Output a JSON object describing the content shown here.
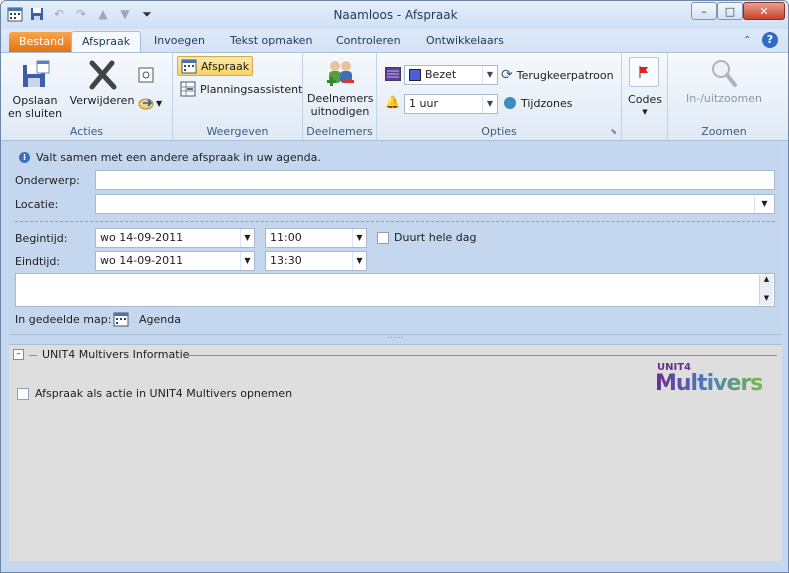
{
  "window": {
    "title": "Naamloos  -  Afspraak",
    "controls": {
      "minimize": "–",
      "maximize": "□",
      "close": "✕"
    }
  },
  "tabs": [
    {
      "label": "Bestand"
    },
    {
      "label": "Afspraak"
    },
    {
      "label": "Invoegen"
    },
    {
      "label": "Tekst opmaken"
    },
    {
      "label": "Controleren"
    },
    {
      "label": "Ontwikkelaars"
    }
  ],
  "ribbon": {
    "acties": {
      "label": "Acties",
      "opslaan": "Opslaan\nen sluiten",
      "verwijderen": "Verwijderen"
    },
    "weergeven": {
      "label": "Weergeven",
      "afspraak": "Afspraak",
      "planning": "Planningsassistent"
    },
    "deelnemers": {
      "label": "Deelnemers",
      "uitnodigen": "Deelnemers\nuitnodigen"
    },
    "opties": {
      "label": "Opties",
      "status": "Bezet",
      "reminder": "1 uur",
      "terugkeer": "Terugkeerpatroon",
      "tijdzones": "Tijdzones"
    },
    "codes": {
      "label": "Codes"
    },
    "zoomen": {
      "label": "Zoomen",
      "zoom": "In-/uitzoomen"
    }
  },
  "form": {
    "info": "Valt samen met een andere afspraak in uw agenda.",
    "onderwerp_label": "Onderwerp:",
    "onderwerp_value": "",
    "locatie_label": "Locatie:",
    "locatie_value": "",
    "begintijd_label": "Begintijd:",
    "begin_date": "wo 14-09-2011",
    "begin_time": "11:00",
    "eindtijd_label": "Eindtijd:",
    "eind_date": "wo 14-09-2011",
    "eind_time": "13:30",
    "allday_label": "Duurt hele dag",
    "map_label": "In gedeelde map:",
    "map_value": "Agenda"
  },
  "multivers": {
    "header": "UNIT4 Multivers Informatie",
    "collapse": "–",
    "checkbox_label": "Afspraak als actie in UNIT4 Multivers opnemen",
    "logo_top": "UNIT4",
    "logo_main": "Multivers"
  },
  "colors": {
    "file_tab": "#e36d10",
    "accent": "#3b5a82",
    "logo_purple": "#6b2d8f",
    "logo_green": "#7ab648"
  }
}
